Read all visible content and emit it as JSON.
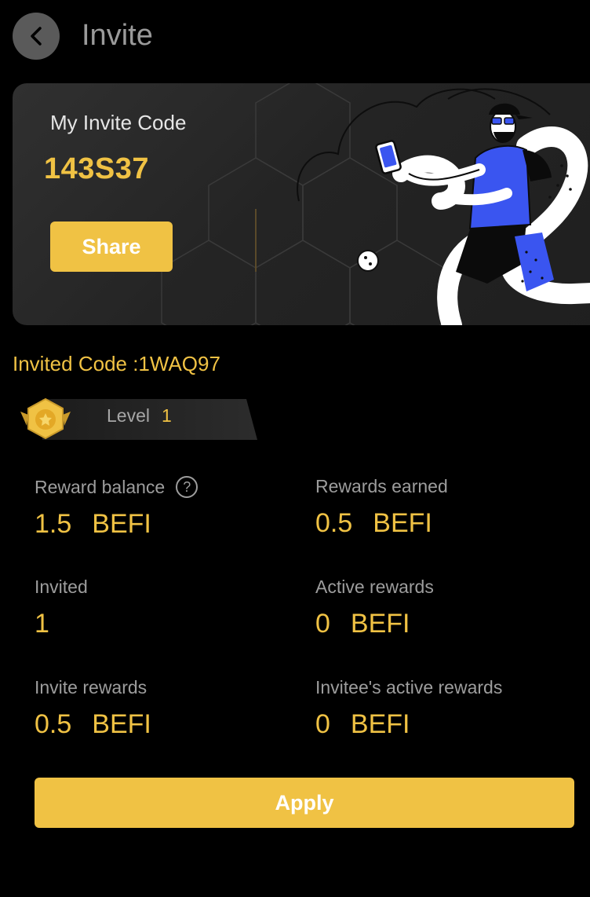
{
  "header": {
    "title": "Invite",
    "back_icon": "chevron-left-icon"
  },
  "invite_card": {
    "label": "My Invite Code",
    "code": "143S37",
    "share_label": "Share",
    "illustration": "person-with-phone-illustration"
  },
  "invited_code": "Invited Code :1WAQ97",
  "level": {
    "label": "Level",
    "value": "1",
    "badge_icon": "medal-star-icon"
  },
  "stats": {
    "reward_balance": {
      "label": "Reward balance",
      "amount": "1.5",
      "unit": "BEFI"
    },
    "rewards_earned": {
      "label": "Rewards earned",
      "amount": "0.5",
      "unit": "BEFI"
    },
    "invited": {
      "label": "Invited",
      "amount": "1"
    },
    "active_rewards": {
      "label": "Active rewards",
      "amount": "0",
      "unit": "BEFI"
    },
    "invite_rewards": {
      "label": "Invite rewards",
      "amount": "0.5",
      "unit": "BEFI"
    },
    "invitee_active_rewards": {
      "label": "Invitee's active rewards",
      "amount": "0",
      "unit": "BEFI"
    }
  },
  "help_symbol": "?",
  "apply_label": "Apply",
  "colors": {
    "background": "#000000",
    "accent": "#f0c244",
    "muted_text": "#9d9d9d",
    "card": "#2a2a2a",
    "figure_blue": "#3a55f0"
  }
}
